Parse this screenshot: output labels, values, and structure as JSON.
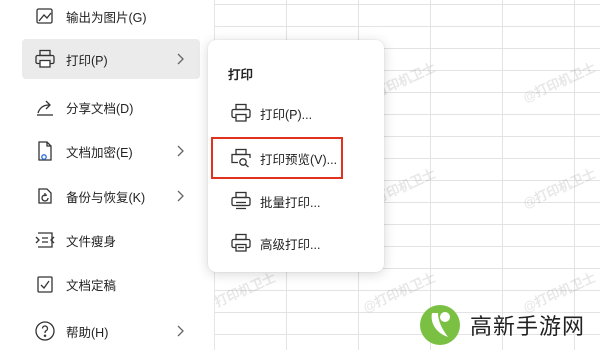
{
  "menu": {
    "items": [
      {
        "label": "输出为图片(G)",
        "icon": "export-image-icon",
        "has_submenu": false,
        "selected": false
      },
      {
        "label": "打印(P)",
        "icon": "printer-icon",
        "has_submenu": true,
        "selected": true
      },
      {
        "label": "分享文档(D)",
        "icon": "share-icon",
        "has_submenu": false,
        "selected": false
      },
      {
        "label": "文档加密(E)",
        "icon": "document-lock-icon",
        "has_submenu": true,
        "selected": false
      },
      {
        "label": "备份与恢复(K)",
        "icon": "backup-restore-icon",
        "has_submenu": true,
        "selected": false
      },
      {
        "label": "文件瘦身",
        "icon": "slim-file-icon",
        "has_submenu": false,
        "selected": false
      },
      {
        "label": "文档定稿",
        "icon": "document-finalize-icon",
        "has_submenu": false,
        "selected": false
      },
      {
        "label": "帮助(H)",
        "icon": "help-icon",
        "has_submenu": true,
        "selected": false
      }
    ]
  },
  "submenu": {
    "title": "打印",
    "items": [
      {
        "label": "打印(P)...",
        "icon": "printer-icon"
      },
      {
        "label": "打印预览(V)...",
        "icon": "print-preview-icon",
        "highlighted": true
      },
      {
        "label": "批量打印...",
        "icon": "batch-print-icon"
      },
      {
        "label": "高级打印...",
        "icon": "advanced-print-icon"
      }
    ]
  },
  "watermark": "@打印机卫士",
  "brand": {
    "name": "高新手游网",
    "icon": "brand-logo-icon"
  },
  "colors": {
    "highlight": "#e0321e",
    "selected_bg": "#ebebeb",
    "brand_green": "#7ac143"
  }
}
